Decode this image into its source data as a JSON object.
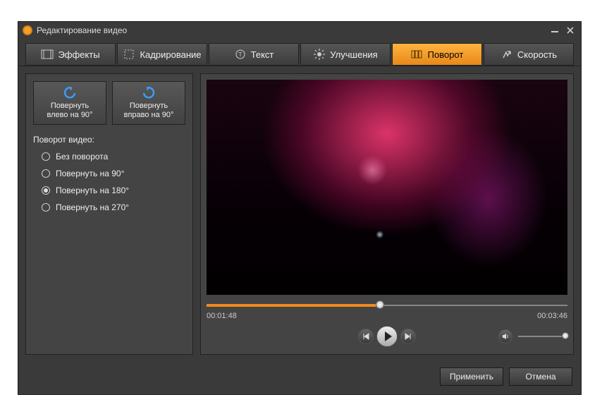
{
  "window": {
    "title": "Редактирование видео"
  },
  "tabs": {
    "effects": "Эффекты",
    "crop": "Кадрирование",
    "text": "Текст",
    "enhance": "Улучшения",
    "rotate": "Поворот",
    "speed": "Скорость",
    "active": "rotate"
  },
  "rotate_panel": {
    "left_btn_line1": "Повернуть",
    "left_btn_line2": "влево  на 90°",
    "right_btn_line1": "Повернуть",
    "right_btn_line2": "вправо на 90°",
    "section_label": "Поворот видео:",
    "options": {
      "none": "Без поворота",
      "r90": "Повернуть на 90°",
      "r180": "Повернуть на 180°",
      "r270": "Повернуть на 270°"
    },
    "selected": "r180"
  },
  "player": {
    "current_time": "00:01:48",
    "total_time": "00:03:46",
    "progress_pct": 48
  },
  "footer": {
    "apply": "Применить",
    "cancel": "Отмена"
  },
  "colors": {
    "accent": "#f18a1b"
  }
}
